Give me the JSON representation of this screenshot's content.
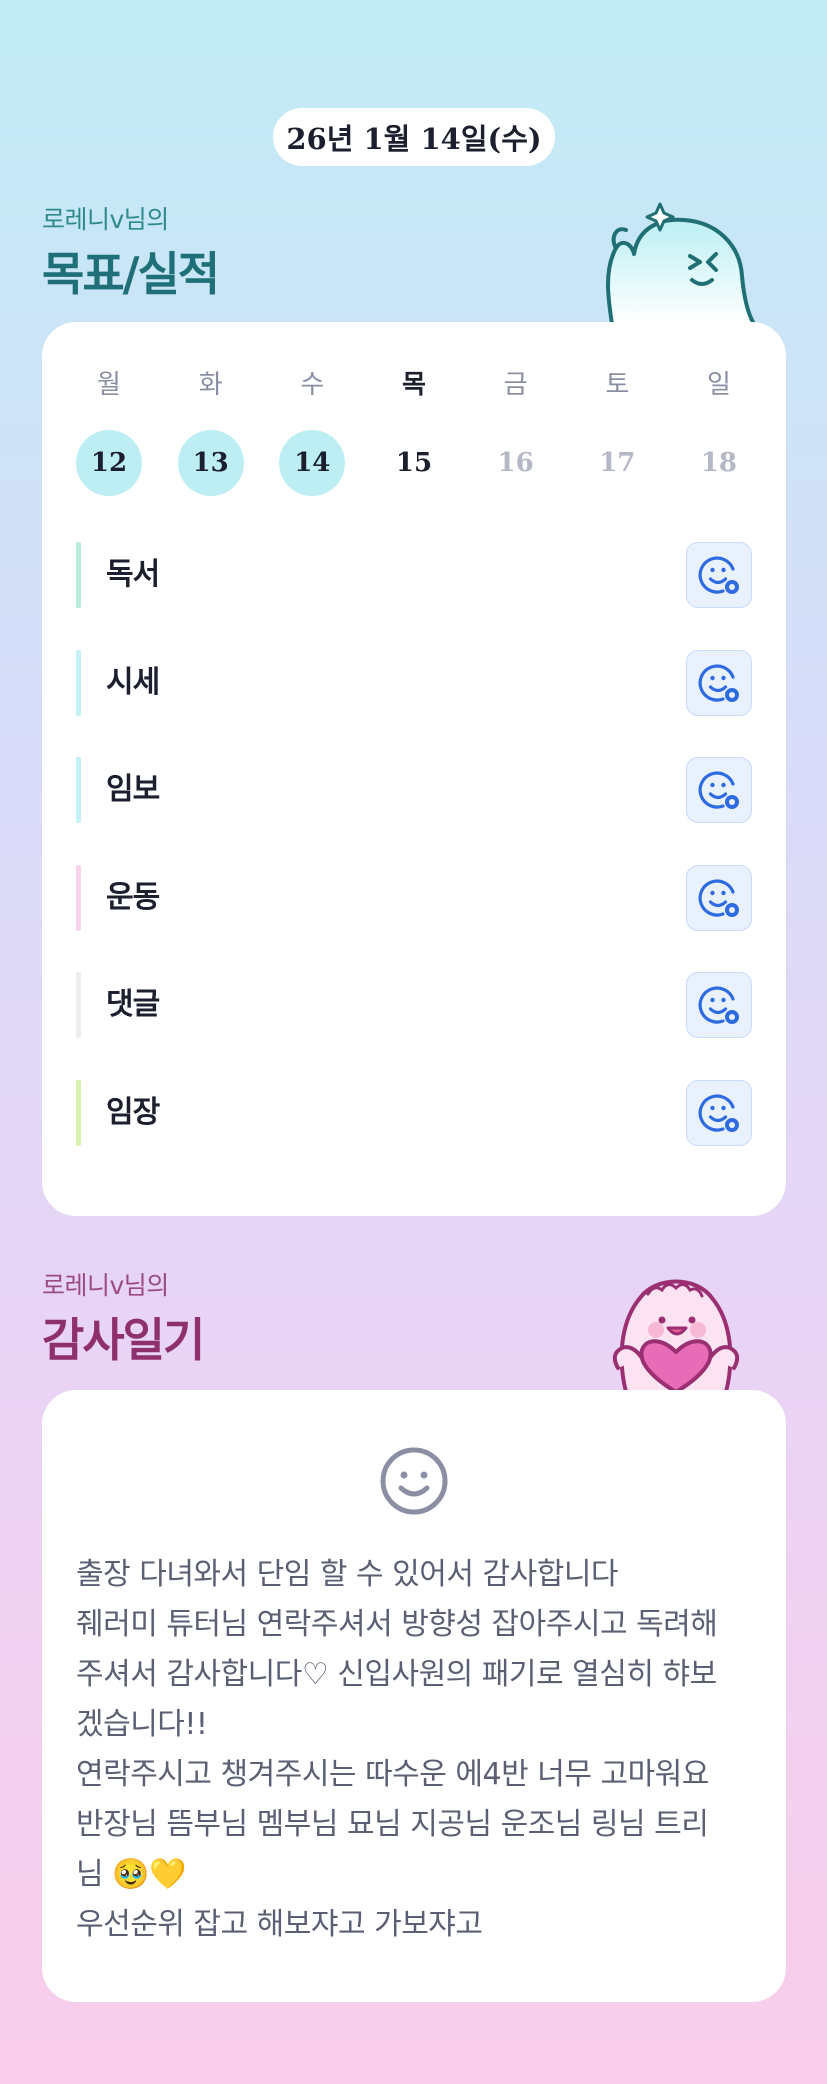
{
  "header": {
    "date": "26년 1월 14일(수)"
  },
  "goals_section": {
    "subtitle": "로레니v님의",
    "title": "목표/실적",
    "week": [
      {
        "name": "월",
        "num": "12",
        "state": "done"
      },
      {
        "name": "화",
        "num": "13",
        "state": "done"
      },
      {
        "name": "수",
        "num": "14",
        "state": "done"
      },
      {
        "name": "목",
        "num": "15",
        "state": "today"
      },
      {
        "name": "금",
        "num": "16",
        "state": "future"
      },
      {
        "name": "토",
        "num": "17",
        "state": "future"
      },
      {
        "name": "일",
        "num": "18",
        "state": "future"
      }
    ],
    "goals": [
      {
        "label": "독서",
        "color": "#b8eed9"
      },
      {
        "label": "시세",
        "color": "#c5f0f7"
      },
      {
        "label": "임보",
        "color": "#c5f0f7"
      },
      {
        "label": "운동",
        "color": "#f9d3ec"
      },
      {
        "label": "댓글",
        "color": "#eeeeef"
      },
      {
        "label": "임장",
        "color": "#d8f2b2"
      }
    ],
    "goal_button_icon": "smiley-add-icon"
  },
  "thanks_section": {
    "subtitle": "로레니v님의",
    "title": "감사일기",
    "lines": [
      "출장 다녀와서 단임 할 수 있어서 감사합니다",
      "줴러미 튜터님 연락주셔서 방향성 잡아주시고 독려해",
      "주셔서 감사합니다♡ 신입사원의 패기로 열심히 햐보",
      "겠습니다!!",
      "연락주시고 챙겨주시는 따수운 에4반 너무 고마워요",
      "반장님 뜸부님 멤부님 묘님 지공님 운조님 링님 트리",
      "님 🥹💛",
      "우선순위 잡고 해보쟈고 가보쟈고"
    ]
  },
  "colors": {
    "done_day": "#bdeef3",
    "goals_title": "#1e6f78",
    "thanks_title": "#8e2f6e",
    "goal_button_bg": "#e9f1fd",
    "goal_button_icon": "#2f6be0"
  }
}
